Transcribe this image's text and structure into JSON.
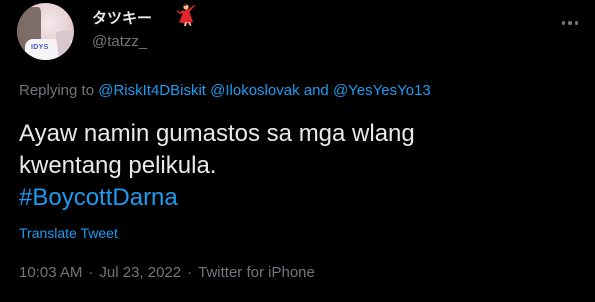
{
  "author": {
    "display_name": "タツキー",
    "display_name_emoji": "woman-dancing-icon",
    "handle": "@tatzz_",
    "avatar_shirt_text": "IDYS"
  },
  "reply": {
    "prefix": "Replying to",
    "mention_1": "@RiskIt4DBiskit",
    "mention_2": "@Ilokoslovak",
    "conjunction": "and",
    "mention_3": "@YesYesYo13"
  },
  "tweet": {
    "line_1": "Ayaw namin gumastos sa mga wlang",
    "line_2": "kwentang pelikula.",
    "hashtag": "#BoycottDarna",
    "translate_label": "Translate Tweet"
  },
  "meta": {
    "time": "10:03 AM",
    "separator": "·",
    "date": "Jul 23, 2022",
    "source": "Twitter for iPhone"
  },
  "colors": {
    "background": "#000000",
    "text": "#e7e9ea",
    "secondary": "#71767b",
    "link": "#1d9bf0"
  }
}
